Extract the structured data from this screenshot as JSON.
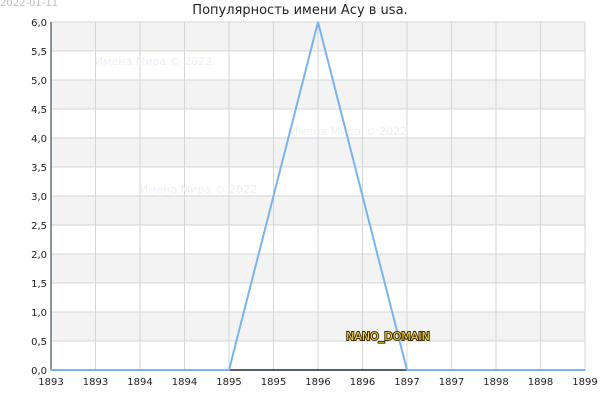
{
  "date_stamp": "2022-01-11",
  "title": "Популярность имени Асу в usa.",
  "watermarks": [
    "Имена Мира © 2022",
    "Имена Мира © 2022",
    "Имена Мира © 2022"
  ],
  "badge": "NANO_DOMAIN",
  "colors": {
    "line": "#7ab3ee",
    "band": "#f3f3f3",
    "grid": "#d6d6d6",
    "axis": "#1f2a44"
  },
  "chart_data": {
    "type": "line",
    "title": "Популярность имени Асу в usa.",
    "xlabel": "",
    "ylabel": "",
    "x_tick_labels": [
      "1893",
      "1893",
      "1894",
      "1894",
      "1895",
      "1895",
      "1896",
      "1896",
      "1897",
      "1897",
      "1898",
      "1898",
      "1899"
    ],
    "y_tick_labels": [
      "0,0",
      "0,5",
      "1,0",
      "1,5",
      "2,0",
      "2,5",
      "3,0",
      "3,5",
      "4,0",
      "4,5",
      "5,0",
      "5,5",
      "6,0"
    ],
    "xlim": [
      1893,
      1899
    ],
    "ylim": [
      0,
      6
    ],
    "grid": true,
    "legend": "none",
    "series": [
      {
        "x": [
          1893,
          1894,
          1895,
          1896,
          1897,
          1898,
          1899
        ],
        "values": [
          0,
          0,
          0,
          6,
          0,
          0,
          0
        ]
      }
    ]
  }
}
